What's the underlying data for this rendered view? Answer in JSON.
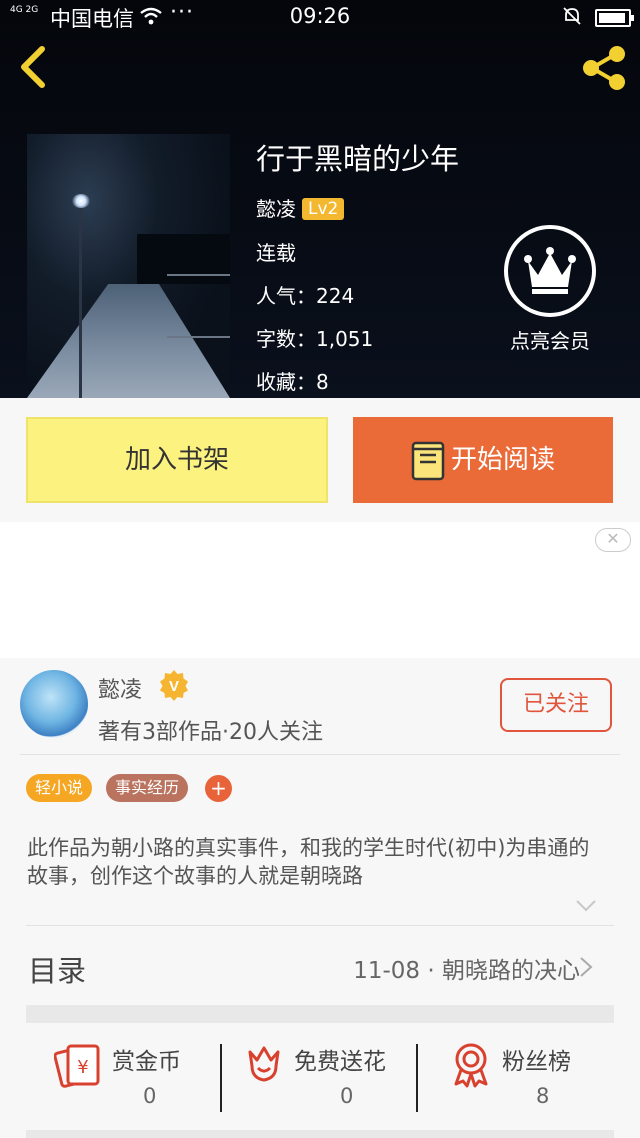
{
  "status_bar": {
    "network": "4G 2G",
    "carrier": "中国电信",
    "dots": "···",
    "time": "09:26"
  },
  "book": {
    "title": "行于黑暗的少年",
    "author": "懿凌",
    "level": "Lv2",
    "status": "连载",
    "popularity": "人气：224",
    "word_count": "字数：1,051",
    "favorites": "收藏：8"
  },
  "vip": {
    "label": "点亮会员"
  },
  "actions": {
    "add_shelf": "加入书架",
    "start_read": "开始阅读"
  },
  "ad": {
    "close": "✕"
  },
  "author_card": {
    "name": "懿凌",
    "badge": "V",
    "stats": "著有3部作品·20人关注",
    "follow_label": "已关注"
  },
  "tags": [
    "轻小说",
    "事实经历"
  ],
  "tag_add": "+",
  "description": "此作品为朝小路的真实事件，和我的学生时代(初中)为串通的故事，创作这个故事的人就是朝晓路",
  "toc": {
    "label": "目录",
    "latest": "11-08 · 朝晓路的决心"
  },
  "stats": [
    {
      "label": "赏金币",
      "value": "0"
    },
    {
      "label": "免费送花",
      "value": "0"
    },
    {
      "label": "粉丝榜",
      "value": "8"
    }
  ],
  "colors": {
    "accent_orange": "#ea6a38",
    "shelf_yellow": "#fbf280",
    "tag_orange": "#f5a623",
    "tag_brown": "#b9735e",
    "icon_red": "#d9412f"
  }
}
